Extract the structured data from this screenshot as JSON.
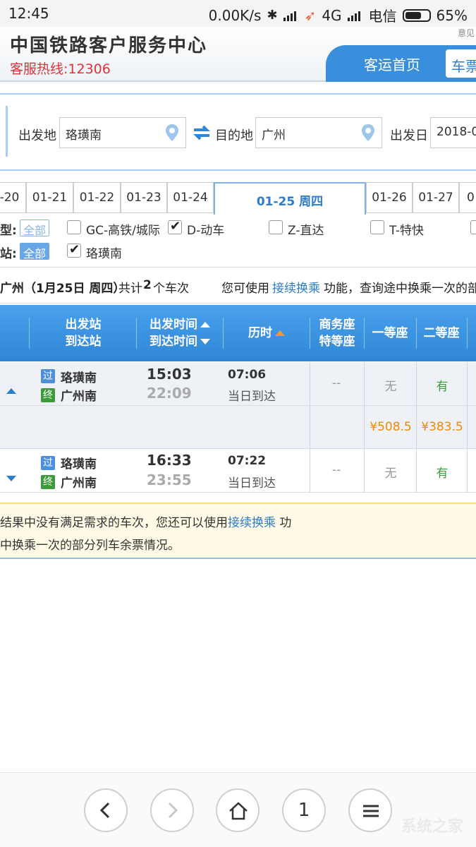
{
  "status_bar": {
    "time": "12:45",
    "speed": "0.00K/s",
    "network": "4G",
    "carrier": "电信",
    "battery": "65%"
  },
  "header": {
    "title": "中国铁路客户服务中心",
    "hotline": "客服热线:12306",
    "corner_note": "意见",
    "nav_home": "客运首页",
    "nav_ticket": "车票"
  },
  "search": {
    "from_label": "出发地",
    "from_value": "珞璜南",
    "to_label": "目的地",
    "to_value": "广州",
    "date_label": "出发日",
    "date_value": "2018-0"
  },
  "date_tabs": [
    "-20",
    "01-21",
    "01-22",
    "01-23",
    "01-24",
    "01-25 周四",
    "01-26",
    "01-27",
    "0"
  ],
  "active_date_index": 5,
  "filters": {
    "type_label": "型:",
    "type_all": "全部",
    "types": [
      {
        "label": "GC-高铁/城际",
        "checked": false
      },
      {
        "label": "D-动车",
        "checked": true
      },
      {
        "label": "Z-直达",
        "checked": false
      },
      {
        "label": "T-特快",
        "checked": false
      }
    ],
    "station_label": "站:",
    "station_all": "全部",
    "stations": [
      {
        "label": "珞璜南",
        "checked": true
      }
    ]
  },
  "summary": {
    "route_prefix": "广州（1月25日  周四）",
    "count_prefix": "共计",
    "count": "2",
    "count_suffix": "个车次",
    "tip_prefix": "您可使用",
    "tip_link": "接续换乘",
    "tip_suffix": "功能，查询途中换乘一次的部"
  },
  "table_header": {
    "col_station_1": "出发站",
    "col_station_2": "到达站",
    "col_time_1": "出发时间",
    "col_time_2": "到达时间",
    "col_duration": "历时",
    "col_business_1": "商务座",
    "col_business_2": "特等座",
    "col_first": "一等座",
    "col_second": "二等座"
  },
  "trains": [
    {
      "from_badge": "过",
      "from": "珞璜南",
      "to_badge": "终",
      "to": "广州南",
      "depart": "15:03",
      "arrive": "22:09",
      "duration": "07:06",
      "arrive_day": "当日到达",
      "business": "--",
      "first": "无",
      "second": "有",
      "price_first": "¥508.5",
      "price_second": "¥383.5"
    },
    {
      "from_badge": "过",
      "from": "珞璜南",
      "to_badge": "终",
      "to": "广州南",
      "depart": "16:33",
      "arrive": "23:55",
      "duration": "07:22",
      "arrive_day": "当日到达",
      "business": "--",
      "first": "无",
      "second": "有"
    }
  ],
  "notice": {
    "line1_prefix": "结果中没有满足需求的车次，您还可以使用",
    "line1_link": "接续换乘",
    "line1_suffix": " 功",
    "line2": "中换乘一次的部分列车余票情况。"
  },
  "browser": {
    "tab_count": "1",
    "watermark": "系统之家"
  },
  "colors": {
    "accent": "#2f86d6",
    "hotline": "#e0323a",
    "available": "#3d9a3a",
    "price": "#f08a00"
  }
}
